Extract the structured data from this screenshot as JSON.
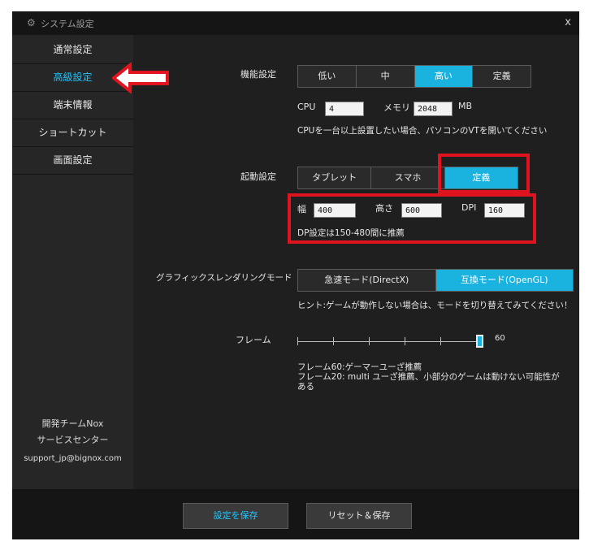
{
  "window": {
    "title": "システム設定",
    "close": "x"
  },
  "sidebar": {
    "items": [
      {
        "label": "通常設定"
      },
      {
        "label": "高級設定"
      },
      {
        "label": "端末情報"
      },
      {
        "label": "ショートカット"
      },
      {
        "label": "画面設定"
      }
    ],
    "active_index": 1,
    "footer": {
      "team": "開発チームNox",
      "support": "サービスセンター",
      "email": "support_jp@bignox.com"
    }
  },
  "performance": {
    "label": "機能設定",
    "options": [
      "低い",
      "中",
      "高い",
      "定義"
    ],
    "selected": "高い",
    "cpu_label": "CPU",
    "cpu_value": "4",
    "memory_label": "メモリ",
    "memory_value": "2048",
    "memory_unit": "MB",
    "hint": "CPUを一台以上設置したい場合、パソコンのVTを開いてください"
  },
  "startup": {
    "label": "起動設定",
    "options": [
      "タブレット",
      "スマホ",
      "定義"
    ],
    "selected": "定義",
    "width_label": "幅",
    "width_value": "400",
    "height_label": "高さ",
    "height_value": "600",
    "dpi_label": "DPI",
    "dpi_value": "160",
    "dpi_hint": "DP設定は150-480間に推薦"
  },
  "graphics": {
    "label": "グラフィックスレンダリングモード",
    "options": [
      "急速モード(DirectX)",
      "互換モード(OpenGL)"
    ],
    "selected": "互換モード(OpenGL)",
    "hint": "ヒント:ゲームが動作しない場合は、モードを切り替えてみてください！"
  },
  "frame": {
    "label": "フレーム",
    "value": "60",
    "level_fraction": 1.0,
    "hint_line1": "フレーム60:ゲーマーユーざ推薦",
    "hint_line2": "フレーム20: multi ユーざ推薦、小部分のゲームは動けない可能性が",
    "hint_line3": "ある"
  },
  "footer": {
    "save_label": "設定を保存",
    "reset_label": "リセット＆保存"
  },
  "colors": {
    "accent": "#1ab2de",
    "highlight_box": "#e0141e",
    "arrow": "#e0141e"
  }
}
